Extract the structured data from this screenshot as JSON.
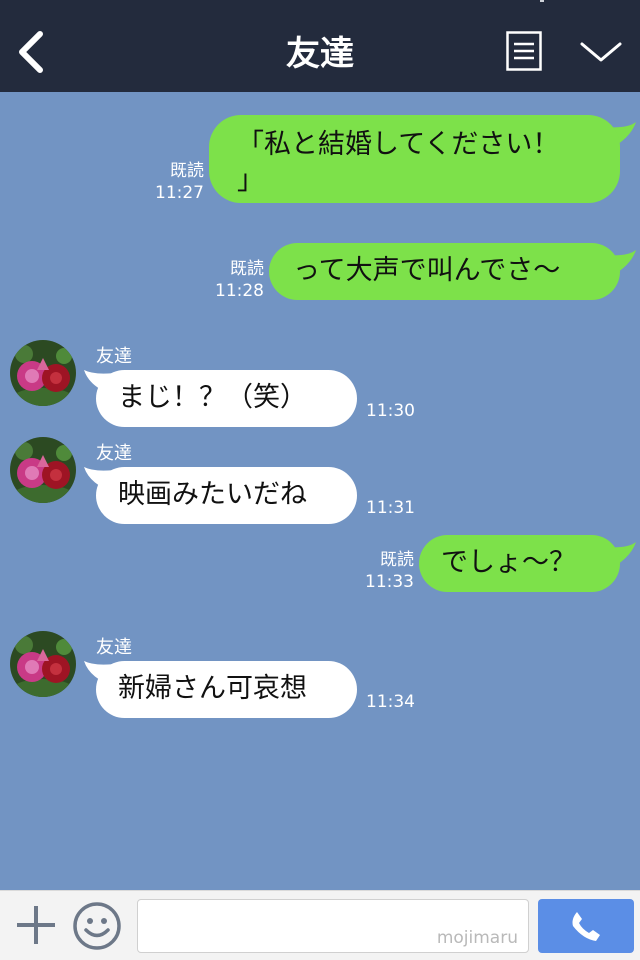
{
  "header": {
    "title": "友達",
    "back_icon": "chevron-left-icon",
    "menu_icon": "menu-list-icon",
    "expand_icon": "chevron-down-icon",
    "background": "#232b3d"
  },
  "chat": {
    "background": "#7294c3",
    "messages": [
      {
        "side": "right",
        "text": "「私と結婚してください！\n」",
        "read": "既読",
        "time": "11:27"
      },
      {
        "side": "right",
        "text": "って大声で叫んでさ〜",
        "read": "既読",
        "time": "11:28"
      },
      {
        "side": "left",
        "sender": "友達",
        "text": "まじ！？（笑）",
        "time": "11:30"
      },
      {
        "side": "left",
        "sender": "友達",
        "text": "映画みたいだね",
        "time": "11:31"
      },
      {
        "side": "right",
        "text": "でしょ〜？",
        "read": "既読",
        "time": "11:33"
      },
      {
        "side": "left",
        "sender": "友達",
        "text": "新婦さん可哀想",
        "time": "11:34"
      }
    ],
    "colors": {
      "sent": "#7de14a",
      "received": "#ffffff"
    }
  },
  "input_bar": {
    "plus_icon": "plus-icon",
    "emoji_icon": "smiley-icon",
    "placeholder": "",
    "watermark": "mojimaru",
    "call_icon": "phone-icon",
    "call_color": "#5b8ee6"
  }
}
